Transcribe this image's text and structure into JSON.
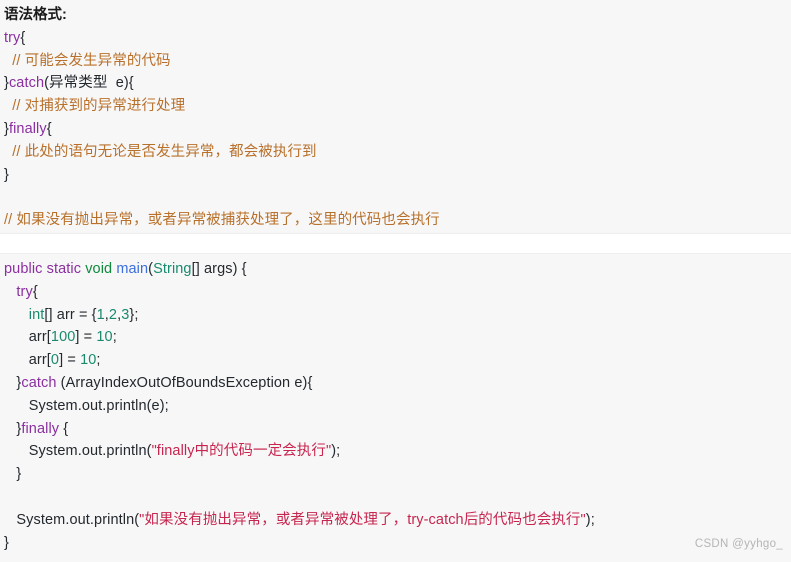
{
  "syntax_block": {
    "heading": "语法格式:",
    "lines": [
      {
        "indent": 0,
        "tokens": [
          {
            "t": "kw",
            "v": "try"
          },
          {
            "t": "plain",
            "v": "{"
          }
        ]
      },
      {
        "indent": 0,
        "tokens": [
          {
            "t": "cmt",
            "v": "  // 可能会发生异常的代码"
          }
        ]
      },
      {
        "indent": 0,
        "tokens": [
          {
            "t": "plain",
            "v": "}"
          },
          {
            "t": "kw",
            "v": "catch"
          },
          {
            "t": "plain",
            "v": "(异常类型  e){"
          }
        ]
      },
      {
        "indent": 0,
        "tokens": [
          {
            "t": "cmt",
            "v": "  // 对捕获到的异常进行处理"
          }
        ]
      },
      {
        "indent": 0,
        "tokens": [
          {
            "t": "plain",
            "v": "}"
          },
          {
            "t": "kw",
            "v": "finally"
          },
          {
            "t": "plain",
            "v": "{"
          }
        ]
      },
      {
        "indent": 0,
        "tokens": [
          {
            "t": "cmt",
            "v": "  // 此处的语句无论是否发生异常，都会被执行到"
          }
        ]
      },
      {
        "indent": 0,
        "tokens": [
          {
            "t": "plain",
            "v": "}"
          }
        ]
      },
      {
        "indent": 0,
        "tokens": [
          {
            "t": "plain",
            "v": ""
          }
        ]
      },
      {
        "indent": 0,
        "tokens": [
          {
            "t": "cmt",
            "v": "// 如果没有抛出异常，或者异常被捕获处理了，这里的代码也会执行"
          }
        ]
      }
    ]
  },
  "example_block": {
    "lines": [
      {
        "tokens": [
          {
            "t": "kw",
            "v": "public static "
          },
          {
            "t": "ret",
            "v": "void "
          },
          {
            "t": "fn",
            "v": "main"
          },
          {
            "t": "plain",
            "v": "("
          },
          {
            "t": "type",
            "v": "String"
          },
          {
            "t": "plain",
            "v": "[] args) {"
          }
        ]
      },
      {
        "tokens": [
          {
            "t": "plain",
            "v": "   "
          },
          {
            "t": "kw",
            "v": "try"
          },
          {
            "t": "plain",
            "v": "{"
          }
        ]
      },
      {
        "tokens": [
          {
            "t": "plain",
            "v": "      "
          },
          {
            "t": "type",
            "v": "int"
          },
          {
            "t": "plain",
            "v": "[] arr = {"
          },
          {
            "t": "type",
            "v": "1"
          },
          {
            "t": "plain",
            "v": ","
          },
          {
            "t": "type",
            "v": "2"
          },
          {
            "t": "plain",
            "v": ","
          },
          {
            "t": "type",
            "v": "3"
          },
          {
            "t": "plain",
            "v": "};"
          }
        ]
      },
      {
        "tokens": [
          {
            "t": "plain",
            "v": "      arr["
          },
          {
            "t": "type",
            "v": "100"
          },
          {
            "t": "plain",
            "v": "] = "
          },
          {
            "t": "type",
            "v": "10"
          },
          {
            "t": "plain",
            "v": ";"
          }
        ]
      },
      {
        "tokens": [
          {
            "t": "plain",
            "v": "      arr["
          },
          {
            "t": "type",
            "v": "0"
          },
          {
            "t": "plain",
            "v": "] = "
          },
          {
            "t": "type",
            "v": "10"
          },
          {
            "t": "plain",
            "v": ";"
          }
        ]
      },
      {
        "tokens": [
          {
            "t": "plain",
            "v": "   }"
          },
          {
            "t": "kw",
            "v": "catch"
          },
          {
            "t": "plain",
            "v": " (ArrayIndexOutOfBoundsException e){"
          }
        ]
      },
      {
        "tokens": [
          {
            "t": "plain",
            "v": "      System.out.println(e);"
          }
        ]
      },
      {
        "tokens": [
          {
            "t": "plain",
            "v": "   }"
          },
          {
            "t": "kw",
            "v": "finally"
          },
          {
            "t": "plain",
            "v": " {"
          }
        ]
      },
      {
        "tokens": [
          {
            "t": "plain",
            "v": "      System.out.println("
          },
          {
            "t": "str",
            "v": "\"finally中的代码一定会执行\""
          },
          {
            "t": "plain",
            "v": ");"
          }
        ]
      },
      {
        "tokens": [
          {
            "t": "plain",
            "v": "   }"
          }
        ]
      },
      {
        "tokens": [
          {
            "t": "plain",
            "v": ""
          }
        ]
      },
      {
        "tokens": [
          {
            "t": "plain",
            "v": "   System.out.println("
          },
          {
            "t": "str",
            "v": "\"如果没有抛出异常，或者异常被处理了，try-catch后的代码也会执行\""
          },
          {
            "t": "plain",
            "v": ");"
          }
        ]
      },
      {
        "tokens": [
          {
            "t": "plain",
            "v": "}"
          }
        ]
      }
    ]
  },
  "watermark": {
    "text": "CSDN @yyhgo_"
  },
  "colors": {
    "background": "#ffffff",
    "code_background": "#f7f7f8",
    "keyword": "#8b2fa0",
    "comment": "#b8702a",
    "type": "#1a8a6d",
    "return_type": "#0f8a3c",
    "function": "#3b6ddb",
    "string": "#c7254e",
    "plain_text": "#24292e",
    "watermark": "#b5b5b5"
  }
}
